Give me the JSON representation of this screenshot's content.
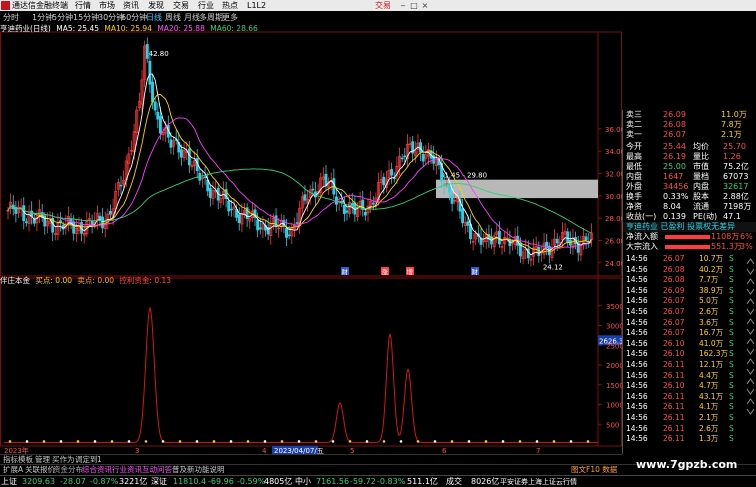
{
  "menubar": {
    "title": "通达信金融终端",
    "items": [
      "行情",
      "市场",
      "资讯",
      "发现",
      "交易",
      "行业",
      "热点",
      "L1L2"
    ],
    "trade_label": "交易"
  },
  "periodbar": {
    "items": [
      "分时",
      "1分钟",
      "5分钟",
      "15分钟",
      "30分钟",
      "60分钟",
      "日线",
      "周线",
      "月线",
      "多周期",
      "更多"
    ],
    "selected": "日线"
  },
  "info": {
    "stock": "亨迪药业(日线)",
    "ma5": "MA5: 25.45",
    "ma10": "MA10: 25.94",
    "ma20": "MA20: 25.88",
    "ma60": "MA60: 28.66"
  },
  "indicator_info": {
    "name": "伴庄本金",
    "a": "买点: 0.00",
    "b": "卖点: 0.00",
    "c": "控利资金: 0.13"
  },
  "chart_data": {
    "type": "candlestick",
    "price_axis_labels": [
      "36.00",
      "34.00",
      "32.00",
      "30.00",
      "28.00",
      "26.00",
      "24.00"
    ],
    "indicator_axis_labels": [
      "3500",
      "3000",
      "2500",
      "2000",
      "1500",
      "1000",
      "500"
    ],
    "annotations": [
      "42.80",
      "31.45 - 29.80",
      "24.12",
      "2626.31"
    ],
    "x_labels": [
      "2023年",
      "3",
      "4",
      "2023/04/07/五",
      "5",
      "6",
      "7"
    ],
    "event_marks": [
      "财",
      "涨",
      "增",
      "财"
    ],
    "ma_legend": [
      "MA5",
      "MA10",
      "MA20",
      "MA60"
    ]
  },
  "quote": {
    "asks": [
      {
        "label": "卖三",
        "price": "26.09",
        "vol": "11.0万"
      },
      {
        "label": "卖二",
        "price": "26.08",
        "vol": "7.8万"
      },
      {
        "label": "卖一",
        "price": "26.07",
        "vol": "2.1万"
      }
    ],
    "fields": [
      {
        "l1": "今开",
        "v1": "25.44",
        "l2": "均价",
        "v2": "25.70"
      },
      {
        "l1": "最高",
        "v1": "26.19",
        "l2": "量比",
        "v2": "1.26"
      },
      {
        "l1": "最低",
        "v1": "25.00",
        "l2": "市值",
        "v2": "75.2亿"
      },
      {
        "l1": "内盘",
        "v1": "1647",
        "l2": "量档",
        "v2": "67073"
      },
      {
        "l1": "外盘",
        "v1": "34456",
        "l2": "内盘",
        "v2": "32617"
      },
      {
        "l1": "换手",
        "v1": "0.33%",
        "l2": "股本",
        "v2": "2.88亿"
      },
      {
        "l1": "净资",
        "v1": "8.04",
        "l2": "流通",
        "v2": "7198万"
      },
      {
        "l1": "收益(一)",
        "v1": "0.139",
        "l2": "PE(动)",
        "v2": "47.1"
      }
    ],
    "tags": "亨迪药业 已盈利 投票权无差异",
    "flows": [
      {
        "label": "净流入额",
        "value": "1108万",
        "pct": "6%"
      },
      {
        "label": "大宗流入",
        "value": "551.3万",
        "pct": "3%"
      }
    ],
    "ticks": [
      {
        "t": "14:56",
        "p": "26.07",
        "v": "10.7万",
        "s": "S"
      },
      {
        "t": "14:56",
        "p": "26.08",
        "v": "40.2万",
        "s": "S"
      },
      {
        "t": "14:56",
        "p": "26.08",
        "v": "7.7万",
        "s": "S"
      },
      {
        "t": "14:56",
        "p": "26.09",
        "v": "38.9万",
        "s": "S"
      },
      {
        "t": "14:56",
        "p": "26.07",
        "v": "5.0万",
        "s": "S"
      },
      {
        "t": "14:56",
        "p": "26.07",
        "v": "2.6万",
        "s": "S"
      },
      {
        "t": "14:56",
        "p": "26.07",
        "v": "3.6万",
        "s": "S"
      },
      {
        "t": "14:56",
        "p": "26.07",
        "v": "16.7万",
        "s": "S"
      },
      {
        "t": "14:56",
        "p": "26.10",
        "v": "41.0万",
        "s": "S"
      },
      {
        "t": "14:56",
        "p": "26.10",
        "v": "162.3万",
        "s": "S"
      },
      {
        "t": "14:56",
        "p": "26.11",
        "v": "12.1万",
        "s": "S"
      },
      {
        "t": "14:56",
        "p": "26.11",
        "v": "4.4万",
        "s": "S"
      },
      {
        "t": "14:56",
        "p": "26.10",
        "v": "4.7万",
        "s": "S"
      },
      {
        "t": "14:56",
        "p": "26.11",
        "v": "43.1万",
        "s": "S"
      },
      {
        "t": "14:56",
        "p": "26.11",
        "v": "4.1万",
        "s": "S"
      },
      {
        "t": "14:56",
        "p": "26.11",
        "v": "2.1万",
        "s": "S"
      },
      {
        "t": "14:56",
        "p": "26.11",
        "v": "2.6万",
        "s": "S"
      },
      {
        "t": "14:56",
        "p": "26.11",
        "v": "1.3万",
        "s": "S"
      }
    ]
  },
  "tabbar": {
    "items": [
      "指标",
      "模板",
      "管理",
      "买作为",
      "调定到",
      "1"
    ]
  },
  "linkbar": {
    "items": [
      "扩展A",
      "关联报价",
      "资金分布",
      "综合资讯",
      "行业资讯",
      "互动问答",
      "普及新功能说明"
    ],
    "right": "图文F10 数据"
  },
  "statusbar": {
    "sh_label": "上证",
    "sh_val": "3209.63",
    "sh_chg": "-28.07",
    "sh_pct": "-0.87%",
    "sh_amt": "3221亿",
    "sz_label": "深证",
    "sz_val": "11810.4",
    "sz_chg": "-69.96",
    "sz_pct": "-0.59%",
    "sz_amt": "4805亿",
    "zx_label": "中小",
    "zx_val": "7161.56",
    "zx_chg": "-59.72",
    "zx_pct": "-0.83%",
    "zx_amt": "511.1亿",
    "cy_label": "成交",
    "cy_amt": "8026亿",
    "broker": "平安证券上海上证云行情"
  },
  "watermark": "www.7gpzb.com",
  "colors": {
    "up": "#ff3b3b",
    "down": "#2ad0e6",
    "ma5": "#ffffff",
    "ma10": "#ffd400",
    "ma20": "#ff3cff",
    "ma60": "#33d17a",
    "indicator": "#d01818"
  }
}
